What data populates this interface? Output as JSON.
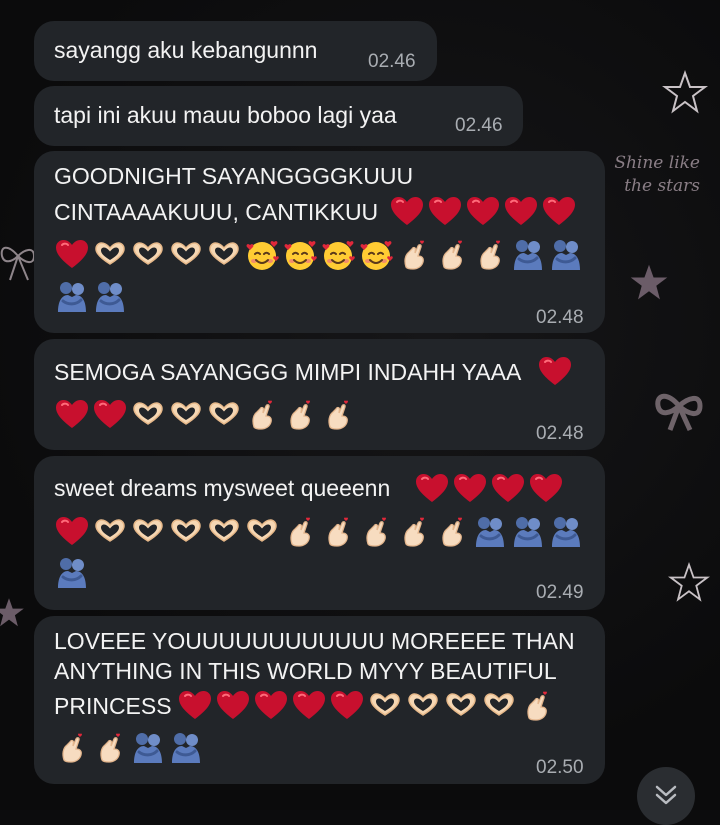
{
  "wallpaper": {
    "caption": "Shine like\nthe stars"
  },
  "messages": [
    {
      "lines": [
        "sayangg aku kebangunnn"
      ],
      "emoji_rows": [],
      "time": "02.46"
    },
    {
      "lines": [
        "tapi ini akuu mauu boboo lagi yaa"
      ],
      "emoji_rows": [],
      "time": "02.46"
    },
    {
      "lines": [
        "GOODNIGHT SAYANGGGGKUUU",
        "CINTAAAAKUUU, CANTIKKUU"
      ],
      "inline_line_emojis": [
        "heart",
        "heart",
        "heart",
        "heart",
        "heart"
      ],
      "emoji_rows": [
        [
          "heart",
          "hand-heart",
          "hand-heart",
          "hand-heart",
          "hand-heart",
          "smiling-face-hearts",
          "smiling-face-hearts",
          "smiling-face-hearts",
          "smiling-face-hearts",
          "finger-heart",
          "finger-heart",
          "finger-heart",
          "people-hugging",
          "people-hugging"
        ],
        [
          "people-hugging",
          "people-hugging"
        ]
      ],
      "time": "02.48"
    },
    {
      "lines": [
        "SEMOGA SAYANGGG MIMPI INDAHH YAAA"
      ],
      "inline_line_emojis": [
        "heart"
      ],
      "emoji_rows": [
        [
          "heart",
          "heart",
          "hand-heart",
          "hand-heart",
          "hand-heart",
          "finger-heart",
          "finger-heart",
          "finger-heart"
        ]
      ],
      "time": "02.48"
    },
    {
      "lines": [
        "sweet dreams mysweet queeenn"
      ],
      "inline_line_emojis": [
        "heart",
        "heart",
        "heart",
        "heart"
      ],
      "emoji_rows": [
        [
          "heart",
          "hand-heart",
          "hand-heart",
          "hand-heart",
          "hand-heart",
          "hand-heart",
          "finger-heart",
          "finger-heart",
          "finger-heart",
          "finger-heart",
          "finger-heart",
          "people-hugging",
          "people-hugging",
          "people-hugging"
        ],
        [
          "people-hugging"
        ]
      ],
      "time": "02.49"
    },
    {
      "lines": [
        "LOVEEE YOUUUUUUUUUUUU MOREEEE THAN",
        "ANYTHING IN THIS WORLD MYYY BEAUTIFUL",
        "PRINCESS"
      ],
      "inline_line_emojis": [
        "heart",
        "heart",
        "heart",
        "heart",
        "heart",
        "hand-heart",
        "hand-heart",
        "hand-heart",
        "hand-heart",
        "finger-heart"
      ],
      "emoji_rows": [
        [
          "finger-heart",
          "finger-heart",
          "people-hugging",
          "people-hugging"
        ]
      ],
      "time": "02.50"
    }
  ],
  "scroll_button": {
    "icon": "double-chevron-down-icon"
  },
  "colors": {
    "bubble": "#222529",
    "text": "#f3f3f3",
    "time": "#a9adb2",
    "heart": "#c8102e",
    "wallpaper_decor": "#5d5158"
  }
}
